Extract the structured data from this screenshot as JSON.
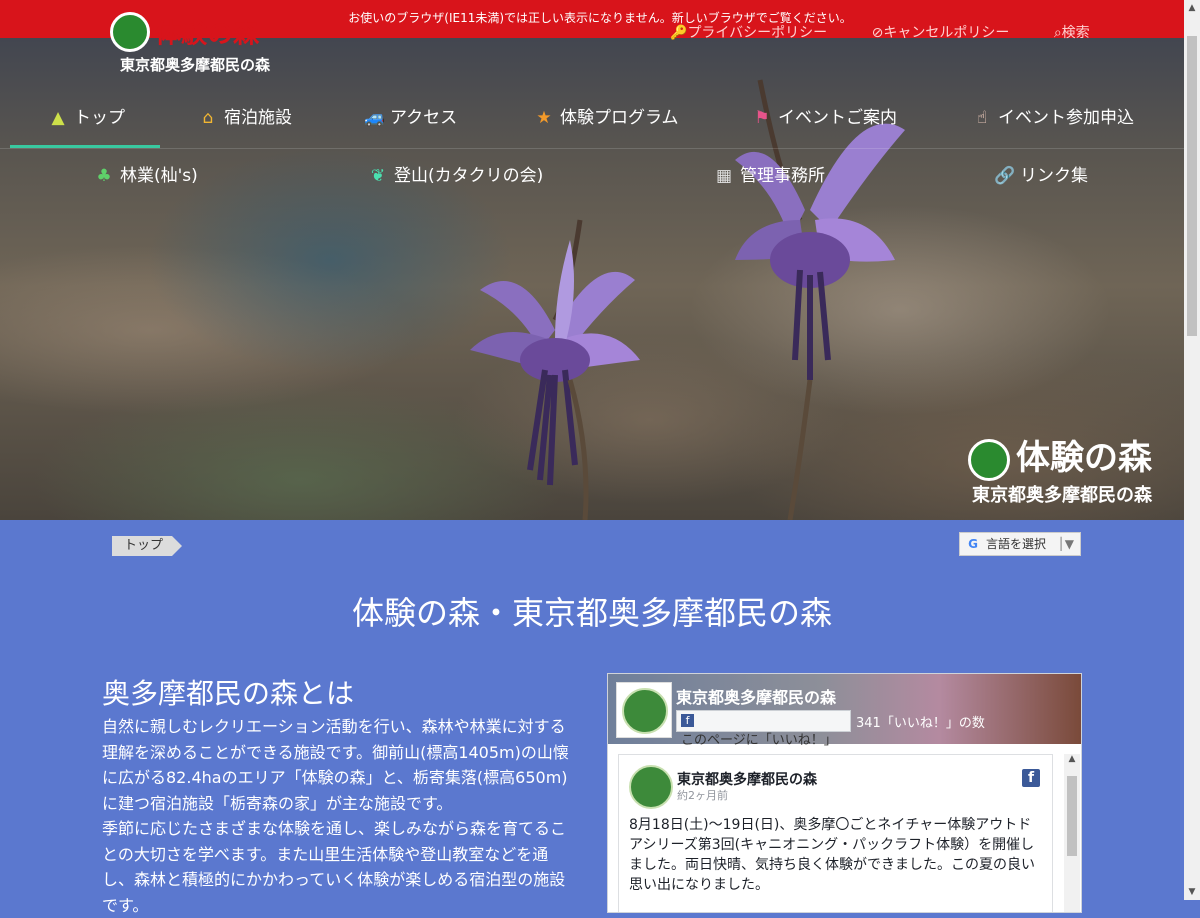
{
  "browser_notice": "お使いのブラウザ(IE11未満)では正しい表示になりません。新しいブラウザでご覧ください。",
  "logo": {
    "title": "体験の森",
    "subtitle": "東京都奥多摩都民の森"
  },
  "utility": {
    "privacy": "プライバシーポリシー",
    "cancel": "キャンセルポリシー",
    "search": "検索"
  },
  "nav_primary": [
    {
      "label": "トップ",
      "icon": "mountain-icon",
      "active": true
    },
    {
      "label": "宿泊施設",
      "icon": "house-icon"
    },
    {
      "label": "アクセス",
      "icon": "car-icon"
    },
    {
      "label": "体験プログラム",
      "icon": "star-icon"
    },
    {
      "label": "イベントご案内",
      "icon": "flag-icon"
    },
    {
      "label": "イベント参加申込",
      "icon": "hand-pointer-icon"
    }
  ],
  "nav_secondary": [
    {
      "label": "林業(杣's)",
      "icon": "trees-icon"
    },
    {
      "label": "登山(カタクリの会)",
      "icon": "leaf-icon"
    },
    {
      "label": "管理事務所",
      "icon": "building-icon"
    },
    {
      "label": "リンク集",
      "icon": "link-icon"
    }
  ],
  "hero_brand": {
    "title": "体験の森",
    "subtitle": "東京都奥多摩都民の森"
  },
  "breadcrumb": "トップ",
  "translate": "言語を選択",
  "page_title": "体験の森・東京都奥多摩都民の森",
  "about": {
    "heading": "奥多摩都民の森とは",
    "paragraphs": [
      "自然に親しむレクリエーション活動を行い、森林や林業に対する理解を深めることができる施設です。御前山(標高1405m)の山懐に広がる82.4haのエリア「体験の森」と、栃寄集落(標高650m)に建つ宿泊施設「栃寄森の家」が主な施設です。",
      "季節に応じたさまざまな体験を通し、楽しみながら森を育てることの大切さを学べます。また山里生活体験や登山教室などを通し、森林と積極的にかかわっていく体験が楽しめる宿泊型の施設です。"
    ]
  },
  "facebook": {
    "page_name": "東京都奥多摩都民の森",
    "like_label": "このページに「いいね！」",
    "like_count": "341「いいね！」の数",
    "post": {
      "author": "東京都奥多摩都民の森",
      "time": "約2ヶ月前",
      "text": "8月18日(土)～19日(日)、奥多摩〇ごとネイチャー体験アウトドアシリーズ第3回(キャニオニング・パックラフト体験）を開催しました。両日快晴、気持ち良く体験ができました。この夏の良い思い出になりました。"
    }
  }
}
